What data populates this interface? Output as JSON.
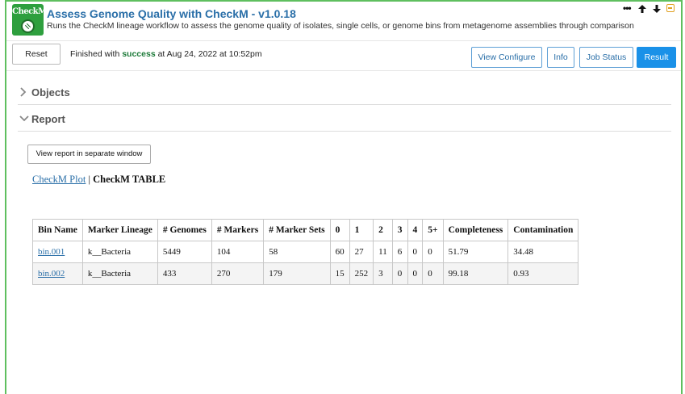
{
  "app": {
    "icon_text": "CheckM",
    "title": "Assess Genome Quality with CheckM - v1.0.18",
    "subtitle": "Runs the CheckM lineage workflow to assess the genome quality of isolates, single cells, or genome bins from metagenome assemblies through comparison"
  },
  "controls": {
    "more": "•••",
    "up": "🡅",
    "down": "🡇"
  },
  "toolbar": {
    "reset_label": "Reset",
    "status_prefix": "Finished with ",
    "status_value": "success",
    "status_suffix": " at Aug 24, 2022 at 10:52pm",
    "tabs": {
      "view_configure": "View Configure",
      "info": "Info",
      "job_status": "Job Status",
      "result": "Result"
    },
    "active_tab": "Result"
  },
  "sections": {
    "objects": {
      "label": "Objects",
      "expanded": false
    },
    "report": {
      "label": "Report",
      "expanded": true
    }
  },
  "report": {
    "view_button": "View report in separate window",
    "link_plot": "CheckM Plot",
    "link_separator": " | ",
    "link_table": "CheckM TABLE"
  },
  "table": {
    "headers": [
      "Bin Name",
      "Marker Lineage",
      "# Genomes",
      "# Markers",
      "# Marker Sets",
      "0",
      "1",
      "2",
      "3",
      "4",
      "5+",
      "Completeness",
      "Contamination"
    ],
    "rows": [
      [
        "bin.001",
        "k__Bacteria",
        "5449",
        "104",
        "58",
        "60",
        "27",
        "11",
        "6",
        "0",
        "0",
        "51.79",
        "34.48"
      ],
      [
        "bin.002",
        "k__Bacteria",
        "433",
        "270",
        "179",
        "15",
        "252",
        "3",
        "0",
        "0",
        "0",
        "99.18",
        "0.93"
      ]
    ]
  },
  "colors": {
    "accent": "#1a91e8",
    "link": "#2a6fa8",
    "success": "#1e7b3a",
    "cell_border": "#5fbf5f"
  }
}
